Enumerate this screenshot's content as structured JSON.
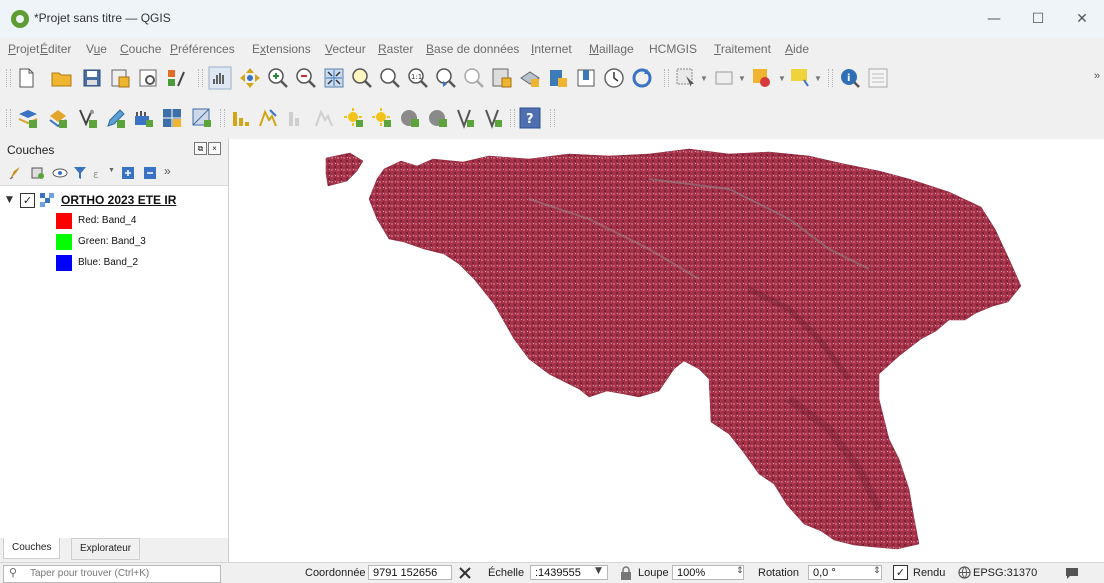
{
  "window": {
    "title": "*Projet sans titre — QGIS",
    "controls": {
      "minimize": "—",
      "maximize": "☐",
      "close": "✕"
    }
  },
  "menu": [
    {
      "label": "Projet",
      "key": "P"
    },
    {
      "label": "Éditer",
      "key": "É"
    },
    {
      "label": "Vue",
      "key": "u"
    },
    {
      "label": "Couche",
      "key": "C"
    },
    {
      "label": "Préférences",
      "key": "P"
    },
    {
      "label": "Extensions",
      "key": "x"
    },
    {
      "label": "Vecteur",
      "key": "V"
    },
    {
      "label": "Raster",
      "key": "R"
    },
    {
      "label": "Base de données",
      "key": "B"
    },
    {
      "label": "Internet",
      "key": "I"
    },
    {
      "label": "Maillage",
      "key": "M"
    },
    {
      "label": "HCMGIS",
      "key": ""
    },
    {
      "label": "Traitement",
      "key": "T"
    },
    {
      "label": "Aide",
      "key": "A"
    }
  ],
  "toolbar1_icons": [
    "new-project-icon",
    "open-project-icon",
    "save-project-icon",
    "save-as-icon",
    "print-layout-icon",
    "style-manager-icon",
    "pan-icon",
    "pan-to-selection-icon",
    "zoom-in-icon",
    "zoom-out-icon",
    "zoom-full-icon",
    "zoom-to-selection-icon",
    "zoom-to-layer-icon",
    "zoom-native-icon",
    "zoom-last-icon",
    "zoom-next-icon",
    "new-map-view-icon",
    "new-3d-view-icon",
    "new-bookmark-icon",
    "show-bookmarks-icon",
    "temporal-controller-icon",
    "refresh-icon",
    "select-features-icon",
    "deselect-icon",
    "measure-icon",
    "annotation-icon",
    "identify-icon",
    "statistics-icon"
  ],
  "toolbar2_icons": [
    "add-vector-layer-icon",
    "add-raster-layer-icon",
    "digitize-icon",
    "edit-pencil-icon",
    "add-wms-icon",
    "add-xyz-icon",
    "add-mesh-icon",
    "histogram-icon",
    "profile-icon",
    "histogram-alt-icon",
    "profile-alt-icon",
    "sun-add-icon",
    "sun-remove-icon",
    "processing-add-icon",
    "processing-remove-icon",
    "vertex-add-icon",
    "vertex-remove-icon",
    "help-icon"
  ],
  "layers_panel": {
    "title": "Couches",
    "layer": {
      "name": "ORTHO 2023 ETE IR",
      "checked": "✓",
      "bands": [
        {
          "label": "Red: Band_4",
          "color": "#ff0000"
        },
        {
          "label": "Green: Band_3",
          "color": "#00ff00"
        },
        {
          "label": "Blue: Band_2",
          "color": "#0000ff"
        }
      ]
    },
    "tabs": [
      "Couches",
      "Explorateur"
    ]
  },
  "status": {
    "locator_placeholder": "Taper pour trouver (Ctrl+K)",
    "coord_label": "Coordonnée",
    "coord_value": "9791  152656",
    "scale_label": "Échelle",
    "scale_value": ":1439555",
    "magnifier_label": "Loupe",
    "magnifier_value": "100%",
    "rotation_label": "Rotation",
    "rotation_value": "0,0 °",
    "render_label": "Rendu",
    "render_checked": "✓",
    "crs": "EPSG:31370"
  },
  "colors": {
    "raster_fill": "#a33249",
    "raster_dark": "#7d2036",
    "raster_light": "#c45b6f"
  }
}
